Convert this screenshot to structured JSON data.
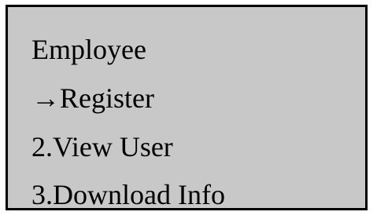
{
  "menu": {
    "title": "Employee",
    "cursor_glyph": "→",
    "items": [
      {
        "label": "Register"
      },
      {
        "label": "2.View User"
      },
      {
        "label": "3.Download Info"
      }
    ]
  }
}
